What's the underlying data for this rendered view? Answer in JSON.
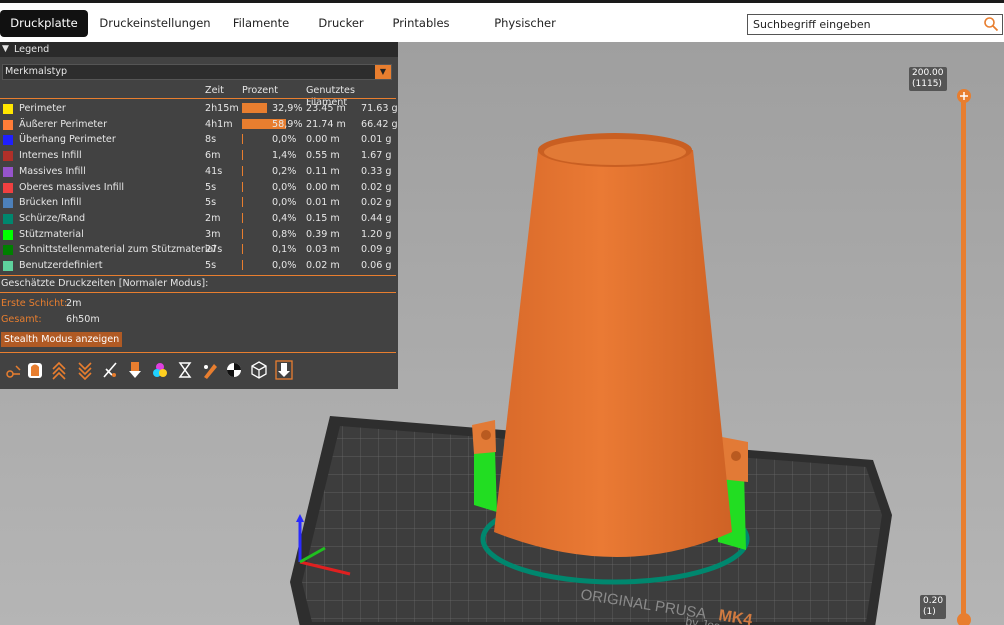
{
  "tabs": [
    {
      "label": "Druckplatte",
      "active": true
    },
    {
      "label": "Druckeinstellungen"
    },
    {
      "label": "Filamente"
    },
    {
      "label": "Drucker"
    },
    {
      "label": "Printables"
    },
    {
      "label": "Physischer Drucker"
    }
  ],
  "search": {
    "placeholder": "Suchbegriff eingeben"
  },
  "legend": {
    "title": "Legend",
    "view_type": "Merkmalstyp",
    "columns": {
      "time": "Zeit",
      "percent": "Prozent",
      "filament": "Genutztes Filament"
    },
    "rows": [
      {
        "name": "Perimeter",
        "color": "#ffe600",
        "time": "2h15m",
        "percent": "32,9%",
        "fraction": 0.329,
        "length": "23.45 m",
        "weight": "71.63 g"
      },
      {
        "name": "Äußerer Perimeter",
        "color": "#ff7d38",
        "time": "4h1m",
        "percent": "58,9%",
        "fraction": 0.589,
        "length": "21.74 m",
        "weight": "66.42 g"
      },
      {
        "name": "Überhang Perimeter",
        "color": "#1f1fff",
        "time": "8s",
        "percent": "0,0%",
        "fraction": 0.0,
        "length": "0.00 m",
        "weight": "0.01 g"
      },
      {
        "name": "Internes Infill",
        "color": "#b03029",
        "time": "6m",
        "percent": "1,4%",
        "fraction": 0.014,
        "length": "0.55 m",
        "weight": "1.67 g"
      },
      {
        "name": "Massives Infill",
        "color": "#9654cc",
        "time": "41s",
        "percent": "0,2%",
        "fraction": 0.002,
        "length": "0.11 m",
        "weight": "0.33 g"
      },
      {
        "name": "Oberes massives Infill",
        "color": "#f04040",
        "time": "5s",
        "percent": "0,0%",
        "fraction": 0.0,
        "length": "0.00 m",
        "weight": "0.02 g"
      },
      {
        "name": "Brücken Infill",
        "color": "#4d80ba",
        "time": "5s",
        "percent": "0,0%",
        "fraction": 0.0,
        "length": "0.01 m",
        "weight": "0.02 g"
      },
      {
        "name": "Schürze/Rand",
        "color": "#00876e",
        "time": "2m",
        "percent": "0,4%",
        "fraction": 0.004,
        "length": "0.15 m",
        "weight": "0.44 g"
      },
      {
        "name": "Stützmaterial",
        "color": "#00ff00",
        "time": "3m",
        "percent": "0,8%",
        "fraction": 0.008,
        "length": "0.39 m",
        "weight": "1.20 g"
      },
      {
        "name": "Schnittstellenmaterial zum Stützmaterial",
        "color": "#008000",
        "time": "27s",
        "percent": "0,1%",
        "fraction": 0.001,
        "length": "0.03 m",
        "weight": "0.09 g"
      },
      {
        "name": "Benutzerdefiniert",
        "color": "#5ed19d",
        "time": "5s",
        "percent": "0,0%",
        "fraction": 0.0,
        "length": "0.02 m",
        "weight": "0.06 g"
      }
    ],
    "estimates_title": "Geschätzte Druckzeiten [Normaler Modus]:",
    "first_layer_label": "Erste Schicht:",
    "first_layer_value": "2m",
    "total_label": "Gesamt:",
    "total_value": "6h50m",
    "stealth_button": "Stealth Modus anzeigen",
    "tools": [
      "travel-icon",
      "wipe-icon",
      "retractions-icon",
      "deretractions-icon",
      "seams-icon",
      "tool-changes-icon",
      "color-changes-icon",
      "pause-prints-icon",
      "custom-gcode-icon",
      "center-of-gravity-icon",
      "shells-icon",
      "tool-marker-icon"
    ]
  },
  "slider": {
    "top_value": "200.00",
    "top_layer": "(1115)",
    "bottom_value": "0.20",
    "bottom_layer": "(1)"
  },
  "bed": {
    "brand_text": "ORIGINAL PRUSA",
    "model_text": "MK4",
    "by_text": "by Jos"
  }
}
